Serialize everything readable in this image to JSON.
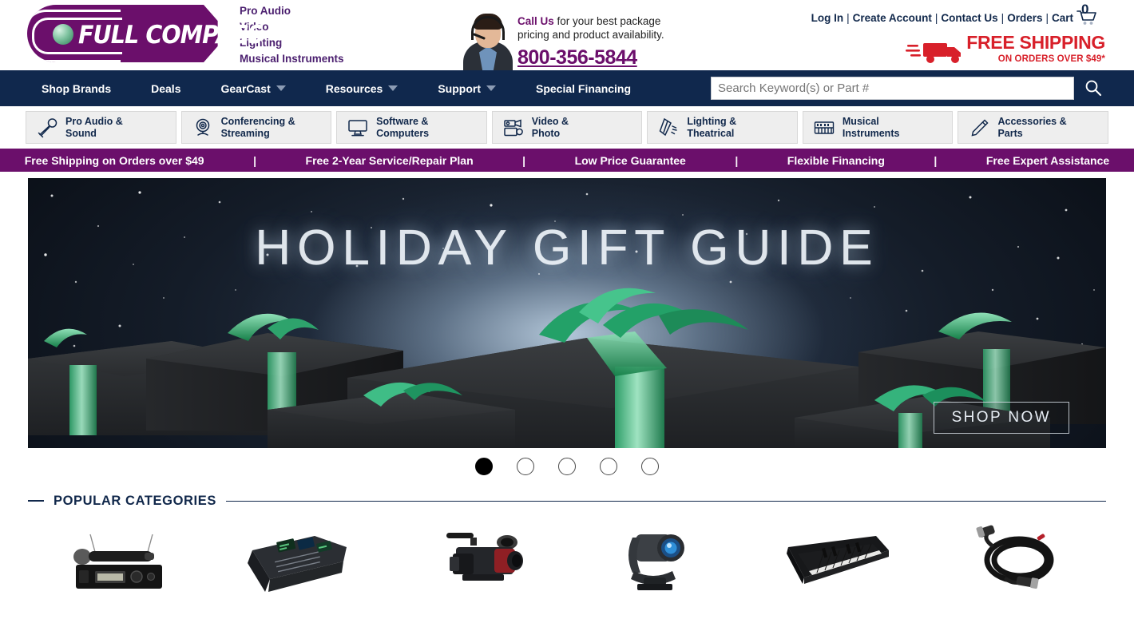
{
  "brand": {
    "logo_text": "FULL COMPASS",
    "categories": [
      "Pro Audio",
      "Video",
      "Lighting",
      "Musical Instruments"
    ]
  },
  "call_us": {
    "lead": "Call Us",
    "line1_rest": " for your best package",
    "line2": "pricing and product availability.",
    "phone": "800-356-5844"
  },
  "top_links": [
    {
      "label": "Log In"
    },
    {
      "label": "Create Account"
    },
    {
      "label": "Contact Us"
    },
    {
      "label": "Orders"
    },
    {
      "label": "Cart"
    }
  ],
  "cart": {
    "count": "0",
    "icon": "cart-icon"
  },
  "free_shipping": {
    "main": "FREE SHIPPING",
    "sub": "ON ORDERS OVER $49*",
    "color": "#d8202a",
    "icon": "delivery-truck-icon"
  },
  "nav": {
    "items": [
      {
        "label": "Shop Brands",
        "has_dropdown": false
      },
      {
        "label": "Deals",
        "has_dropdown": false
      },
      {
        "label": "GearCast",
        "has_dropdown": true
      },
      {
        "label": "Resources",
        "has_dropdown": true
      },
      {
        "label": "Support",
        "has_dropdown": true
      },
      {
        "label": "Special Financing",
        "has_dropdown": false
      }
    ],
    "background": "#10284d"
  },
  "search": {
    "placeholder": "Search Keyword(s) or Part #",
    "value": "",
    "icon": "search-icon"
  },
  "category_tiles": [
    {
      "line1": "Pro Audio &",
      "line2": "Sound",
      "icon": "microphone-icon"
    },
    {
      "line1": "Conferencing &",
      "line2": "Streaming",
      "icon": "webcam-icon"
    },
    {
      "line1": "Software &",
      "line2": "Computers",
      "icon": "desktop-computer-icon"
    },
    {
      "line1": "Video &",
      "line2": "Photo",
      "icon": "camcorder-icon"
    },
    {
      "line1": "Lighting &",
      "line2": "Theatrical",
      "icon": "stage-light-icon"
    },
    {
      "line1": "Musical",
      "line2": "Instruments",
      "icon": "keyboard-piano-icon"
    },
    {
      "line1": "Accessories &",
      "line2": "Parts",
      "icon": "cable-plug-icon"
    }
  ],
  "benefits": {
    "background": "#6b0f6b",
    "separator": "|",
    "items": [
      "Free Shipping on Orders over $49",
      "Free 2-Year Service/Repair Plan",
      "Low Price Guarantee",
      "Flexible Financing",
      "Free Expert Assistance"
    ]
  },
  "hero": {
    "title": "HOLIDAY GIFT GUIDE",
    "cta": "SHOP NOW",
    "description": "Dark charcoal gift boxes with emerald green ribbons on a starry silver-glitter background"
  },
  "carousel": {
    "slide_count": 5,
    "active_index": 0
  },
  "popular_categories": {
    "title": "POPULAR CATEGORIES",
    "products": [
      {
        "name": "wireless-microphone-system"
      },
      {
        "name": "digital-mixing-console"
      },
      {
        "name": "professional-camcorder"
      },
      {
        "name": "moving-head-stage-light"
      },
      {
        "name": "electronic-keyboard"
      },
      {
        "name": "xlr-audio-cable"
      }
    ]
  }
}
